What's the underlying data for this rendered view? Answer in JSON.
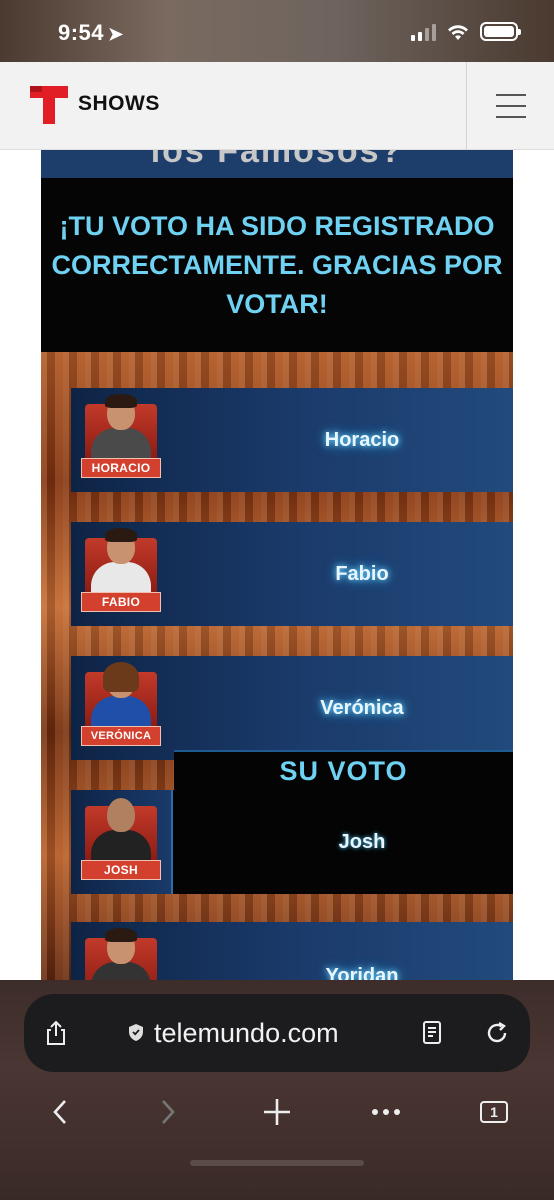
{
  "status_bar": {
    "time": "9:54",
    "location_arrow": "➤"
  },
  "header": {
    "logo_text": "SHOWS",
    "menu_icon": "hamburger-icon"
  },
  "page": {
    "previous_title_fragment": "los Famosos?",
    "thanks_message": "¡TU VOTO HA SIDO REGISTRADO CORRECTAMENTE. GRACIAS POR VOTAR!",
    "su_voto_label": "SU VOTO",
    "candidates": [
      {
        "tag": "HORACIO",
        "name": "Horacio"
      },
      {
        "tag": "FABIO",
        "name": "Fabio"
      },
      {
        "tag": "VERÓNICA",
        "name": "Verónica"
      },
      {
        "tag": "JOSH",
        "name": "Josh"
      },
      {
        "tag": "",
        "name": "Yoridan"
      }
    ]
  },
  "browser": {
    "url": "telemundo.com",
    "tab_count": "1"
  },
  "colors": {
    "accent_cyan": "#6fd2f2",
    "card_blue": "#1a3a6a",
    "tag_red": "#d3412e",
    "telemundo_red": "#e11d26"
  }
}
